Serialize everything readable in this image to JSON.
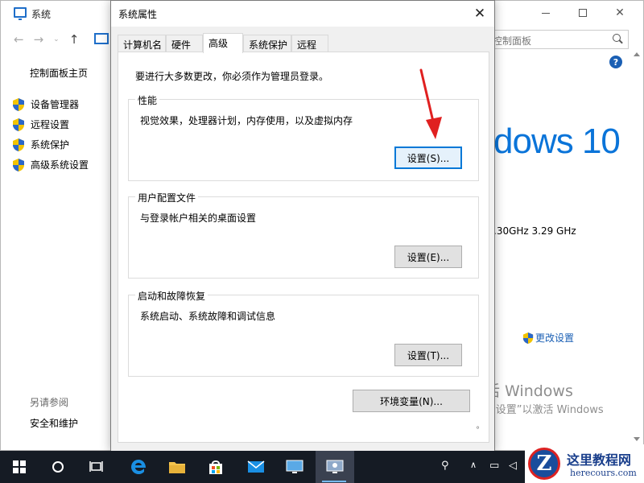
{
  "background_window": {
    "title": "系统",
    "search_placeholder": "控制面板",
    "help_label": "?",
    "sidebar": {
      "home": "控制面板主页",
      "items": [
        {
          "label": "设备管理器"
        },
        {
          "label": "远程设置"
        },
        {
          "label": "系统保护"
        },
        {
          "label": "高级系统设置"
        }
      ],
      "see_also_heading": "另请参阅",
      "see_also_link": "安全和维护"
    },
    "windows_brand": "dows 10",
    "cpu_speed": ".30GHz   3.29 GHz",
    "change_settings": "更改设置",
    "activation_title": "激活 Windows",
    "activation_hint": "转到“设置”以激活 Windows"
  },
  "dialog": {
    "title": "系统属性",
    "close_label": "✕",
    "tabs": [
      {
        "label": "计算机名",
        "active": false
      },
      {
        "label": "硬件",
        "active": false
      },
      {
        "label": "高级",
        "active": true
      },
      {
        "label": "系统保护",
        "active": false
      },
      {
        "label": "远程",
        "active": false
      }
    ],
    "admin_note": "要进行大多数更改，你必须作为管理员登录。",
    "groups": {
      "performance": {
        "label": "性能",
        "description": "视觉效果，处理器计划，内存使用，以及虚拟内存",
        "button": "设置(S)..."
      },
      "user_profiles": {
        "label": "用户配置文件",
        "description": "与登录帐户相关的桌面设置",
        "button": "设置(E)..."
      },
      "startup_recovery": {
        "label": "启动和故障恢复",
        "description": "系统启动、系统故障和调试信息",
        "button": "设置(T)..."
      }
    },
    "env_vars_button": "环境变量(N)..."
  },
  "watermark": {
    "logo_letter": "Z",
    "name": "这里教程网",
    "url": "herecours.com"
  },
  "colors": {
    "accent": "#0078d7",
    "brand_blue": "#0a74d9",
    "arrow_red": "#e02020",
    "taskbar": "#151b24"
  }
}
